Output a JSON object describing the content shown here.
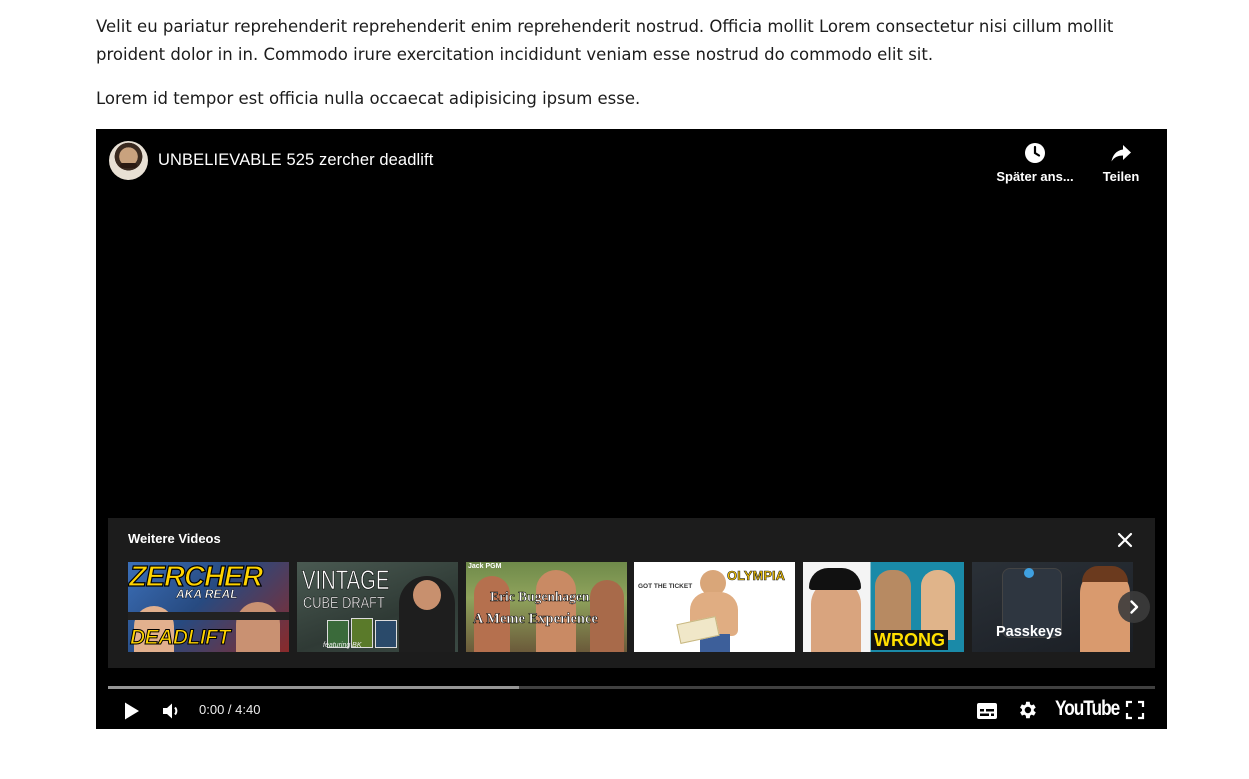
{
  "article": {
    "paragraph_1": "Velit eu pariatur reprehenderit reprehenderit enim reprehenderit nostrud. Officia mollit Lorem consectetur nisi cillum mollit proident dolor in in. Commodo irure exercitation incididunt veniam esse nostrud do commodo elit sit.",
    "paragraph_2": "Lorem id tempor est officia nulla occaecat adipisicing ipsum esse."
  },
  "player": {
    "video_title": "UNBELIEVABLE 525 zercher deadlift",
    "watch_later_label": "Später ans...",
    "share_label": "Teilen",
    "more_videos": {
      "title": "Weitere Videos",
      "thumbnails": [
        {
          "text_1": "ZERCHER",
          "text_2": "AKA REAL",
          "text_3": "DEADLIFT",
          "accent": "#ffd400"
        },
        {
          "text_1": "VINTAGE",
          "text_2": "CUBE DRAFT",
          "text_3": "featuring BK",
          "accent": "#ffffff"
        },
        {
          "text_1": "Jack PGM",
          "text_2": "Eric Bugenhagen",
          "text_3": "A Meme Experience",
          "accent": "#ffffff"
        },
        {
          "text_1": "GOT THE TICKET",
          "text_2": "OLYMPIA",
          "accent": "#f5c400"
        },
        {
          "text_1": "WRONG",
          "accent": "#ffe000"
        },
        {
          "text_1": "Passkeys",
          "accent": "#ffffff"
        }
      ]
    },
    "progress": {
      "played_fraction": 0.0,
      "loaded_fraction": 0.393
    },
    "time_display": "0:00 / 4:40",
    "logo_text": "YouTube",
    "icons": {
      "watch_later": "clock-icon",
      "share": "share-arrow-icon",
      "close": "close-icon",
      "next": "chevron-right-icon",
      "play": "play-icon",
      "volume": "volume-icon",
      "subtitles": "subtitles-icon",
      "settings": "gear-icon",
      "fullscreen": "fullscreen-icon"
    }
  }
}
